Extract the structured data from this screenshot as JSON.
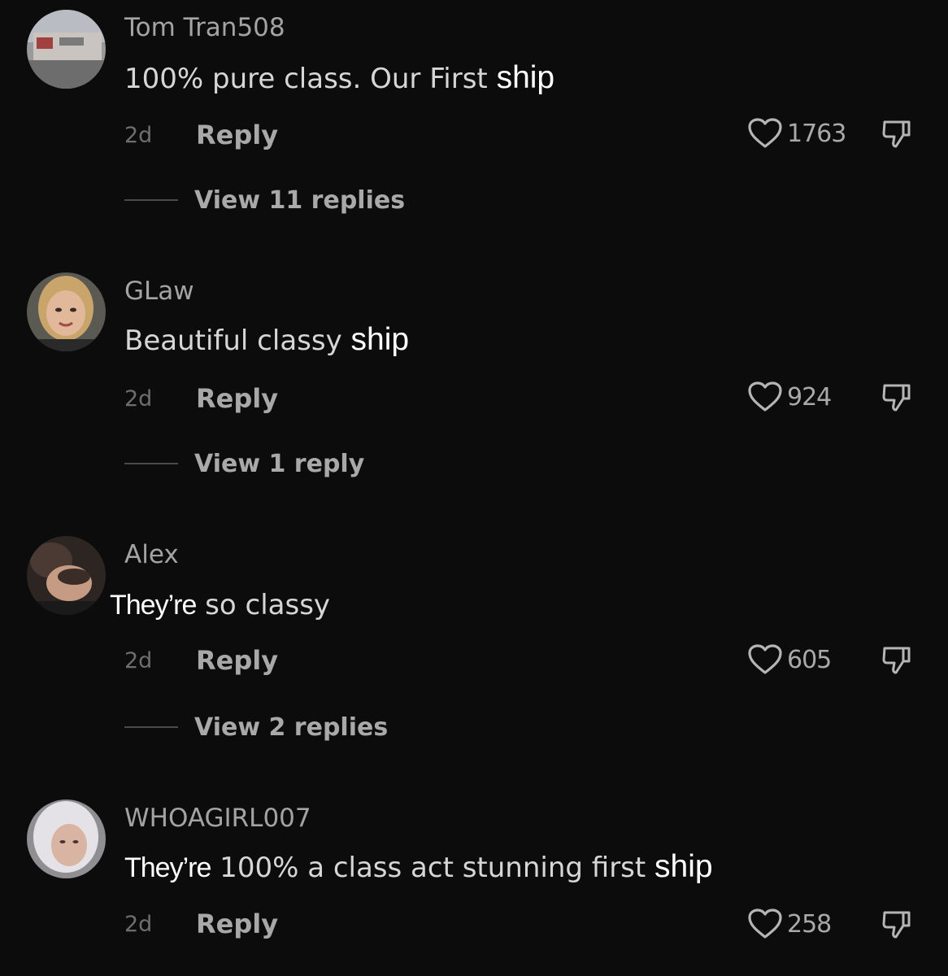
{
  "comments": [
    {
      "username": "Tom Tran508",
      "text_plain": "100% pure class. Our First ",
      "text_edited": "ship",
      "age": "2d",
      "reply_label": "Reply",
      "likes": "1763",
      "view_replies": "View 11 replies"
    },
    {
      "username": "GLaw",
      "text_plain": "Beautiful classy ",
      "text_edited": "ship",
      "age": "2d",
      "reply_label": "Reply",
      "likes": "924",
      "view_replies": "View 1 reply"
    },
    {
      "username": "Alex",
      "text_edited": "They’re",
      "text_plain": " so classy",
      "age": "2d",
      "reply_label": "Reply",
      "likes": "605",
      "view_replies": "View 2 replies"
    },
    {
      "username": "WHOAGIRL007",
      "text_edited": "They’re",
      "text_plain": " 100% a class act stunning first ",
      "text_edited_end": "ship",
      "age": "2d",
      "reply_label": "Reply",
      "likes": "258"
    }
  ],
  "icons": {
    "like": "heart-outline-icon",
    "dislike": "thumbs-down-icon"
  },
  "colors": {
    "background": "#0c0c0c",
    "edited_text": "#ffffff",
    "username": "#a3a3a3"
  }
}
